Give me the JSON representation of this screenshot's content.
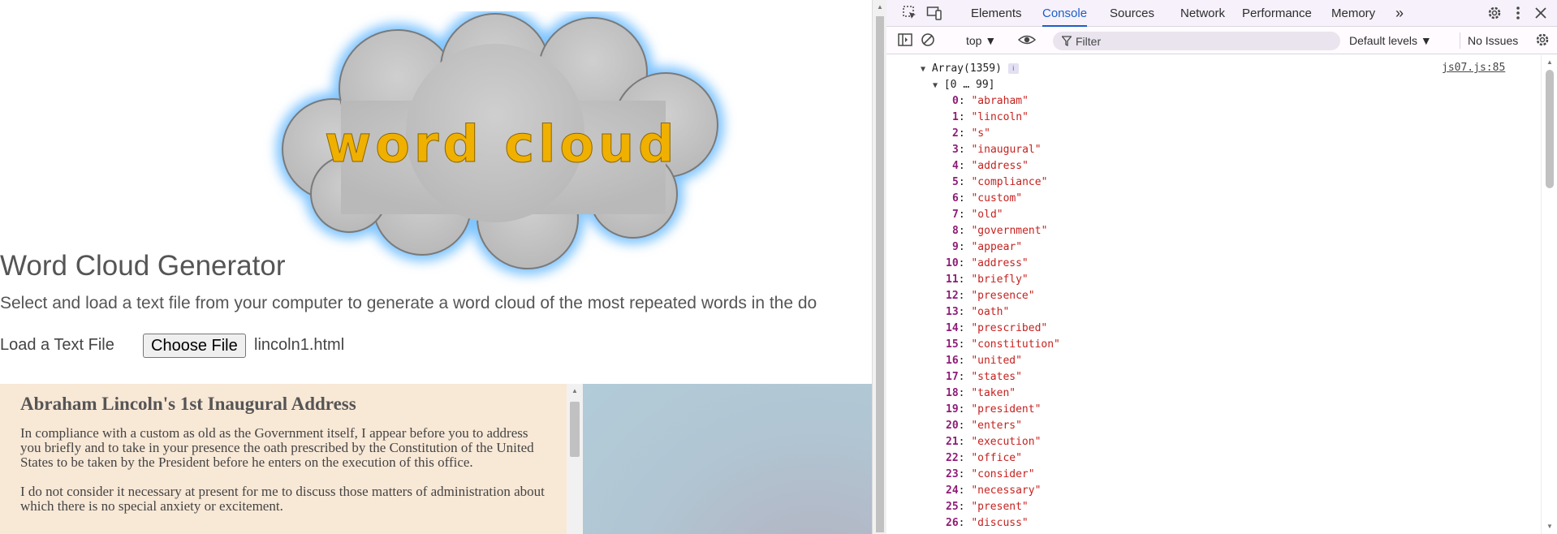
{
  "page": {
    "logo_text": "word cloud",
    "title": "Word Cloud Generator",
    "subtitle": "Select and load a text file from your computer to generate a word cloud of the most repeated words in the do",
    "load_label": "Load a Text File",
    "choose_file_label": "Choose File",
    "file_name": "lincoln1.html",
    "document": {
      "title": "Abraham Lincoln's 1st Inaugural Address",
      "paragraphs": [
        "In compliance with a custom as old as the Government itself, I appear before you to address you briefly and to take in your presence the oath prescribed by the Constitution of the United States to be taken by the President before he enters on the execution of this office.",
        "I do not consider it necessary at present for me to discuss those matters of administration about which there is no special anxiety or excitement."
      ]
    }
  },
  "devtools": {
    "tabs": [
      "Elements",
      "Console",
      "Sources",
      "Network",
      "Performance",
      "Memory"
    ],
    "active_tab": "Console",
    "more_tabs": "»",
    "context": "top ▼",
    "filter_placeholder": "Filter",
    "levels": "Default levels ▼",
    "issues": "No Issues",
    "console": {
      "array_label": "Array(1359)",
      "info_badge": "i",
      "source_link": "js07.js:85",
      "range_label": "[0 … 99]",
      "items": [
        "abraham",
        "lincoln",
        "s",
        "inaugural",
        "address",
        "compliance",
        "custom",
        "old",
        "government",
        "appear",
        "address",
        "briefly",
        "presence",
        "oath",
        "prescribed",
        "constitution",
        "united",
        "states",
        "taken",
        "president",
        "enters",
        "execution",
        "office",
        "consider",
        "necessary",
        "present",
        "discuss"
      ]
    }
  }
}
